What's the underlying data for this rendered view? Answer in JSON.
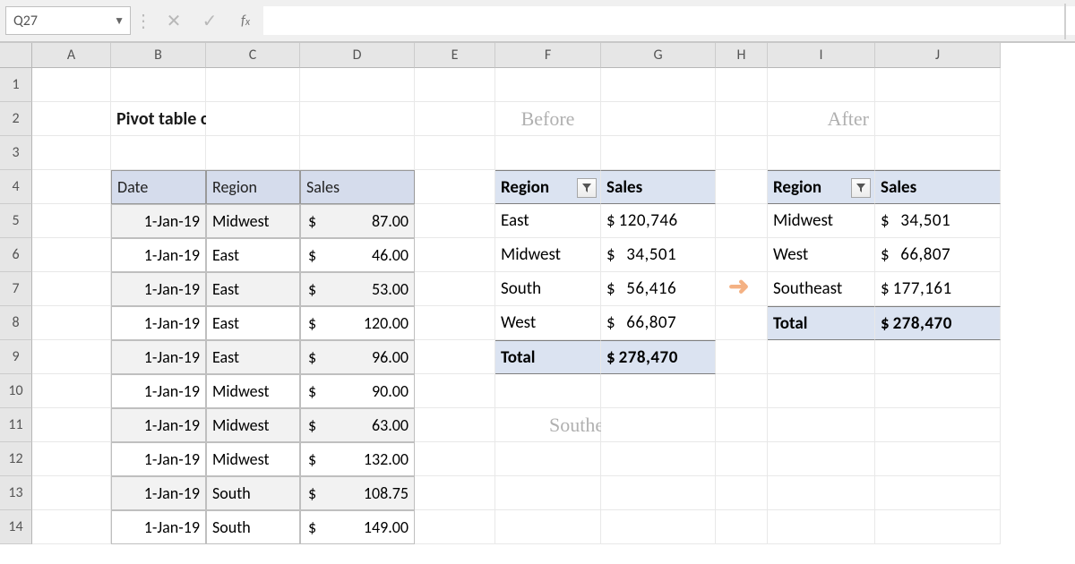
{
  "name_box": "Q27",
  "title": "Pivot table calculated item example",
  "labels": {
    "before": "Before",
    "after": "After"
  },
  "note": "Southeast = South + East",
  "columns": [
    "A",
    "B",
    "C",
    "D",
    "E",
    "F",
    "G",
    "H",
    "I",
    "J"
  ],
  "rows": [
    "1",
    "2",
    "3",
    "4",
    "5",
    "6",
    "7",
    "8",
    "9",
    "10",
    "11",
    "12",
    "13",
    "14"
  ],
  "source": {
    "headers": [
      "Date",
      "Region",
      "Sales"
    ],
    "data": [
      {
        "date": "1-Jan-19",
        "region": "Midwest",
        "sales": "87.00"
      },
      {
        "date": "1-Jan-19",
        "region": "East",
        "sales": "46.00"
      },
      {
        "date": "1-Jan-19",
        "region": "East",
        "sales": "53.00"
      },
      {
        "date": "1-Jan-19",
        "region": "East",
        "sales": "120.00"
      },
      {
        "date": "1-Jan-19",
        "region": "East",
        "sales": "96.00"
      },
      {
        "date": "1-Jan-19",
        "region": "Midwest",
        "sales": "90.00"
      },
      {
        "date": "1-Jan-19",
        "region": "Midwest",
        "sales": "63.00"
      },
      {
        "date": "1-Jan-19",
        "region": "Midwest",
        "sales": "132.00"
      },
      {
        "date": "1-Jan-19",
        "region": "South",
        "sales": "108.75"
      },
      {
        "date": "1-Jan-19",
        "region": "South",
        "sales": "149.00"
      }
    ]
  },
  "pivot_before": {
    "region_h": "Region",
    "sales_h": "Sales",
    "rows": [
      {
        "r": "East",
        "v": "120,746"
      },
      {
        "r": "Midwest",
        "v": "34,501"
      },
      {
        "r": "South",
        "v": "56,416"
      },
      {
        "r": "West",
        "v": "66,807"
      }
    ],
    "total_l": "Total",
    "total_v": "278,470"
  },
  "pivot_after": {
    "region_h": "Region",
    "sales_h": "Sales",
    "rows": [
      {
        "r": "Midwest",
        "v": "34,501"
      },
      {
        "r": "West",
        "v": "66,807"
      },
      {
        "r": "Southeast",
        "v": "177,161"
      }
    ],
    "total_l": "Total",
    "total_v": "278,470"
  },
  "cur": "$"
}
